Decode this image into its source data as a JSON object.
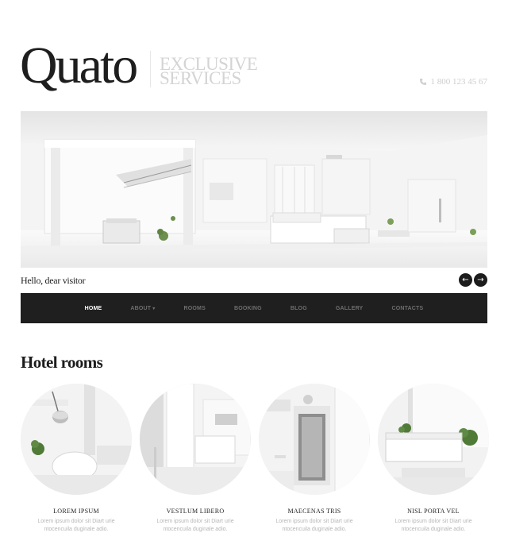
{
  "header": {
    "logo": "Quato",
    "tagline_line1": "EXCLUSIVE",
    "tagline_line2": "SERVICES",
    "phone": "1 800 123 45 67",
    "phone_icon": "phone-icon"
  },
  "hero": {
    "image": "white-living-room-interior"
  },
  "welcome": {
    "text": "Hello, dear visitor",
    "prev": "←",
    "next": "→"
  },
  "nav": {
    "items": [
      {
        "label": "HOME",
        "active": true
      },
      {
        "label": "ABOUT",
        "dropdown": true
      },
      {
        "label": "ROOMS"
      },
      {
        "label": "BOOKING"
      },
      {
        "label": "BLOG"
      },
      {
        "label": "GALLERY"
      },
      {
        "label": "CONTACTS"
      }
    ],
    "caret": "▾"
  },
  "rooms_section": {
    "title": "Hotel rooms",
    "rooms": [
      {
        "title": "LOREM IPSUM",
        "desc_line1": "Lorem ipsum dolor sit Diart urie",
        "desc_line2": "ntocencuila duginale adio."
      },
      {
        "title": "VESTLUM LIBERO",
        "desc_line1": "Lorem ipsum dolor sit Diart urie",
        "desc_line2": "ntocencuila duginale adio."
      },
      {
        "title": "MAECENAS TRIS",
        "desc_line1": "Lorem ipsum dolor sit Diart urie",
        "desc_line2": "ntocencuila duginale adio."
      },
      {
        "title": "NISL PORTA VEL",
        "desc_line1": "Lorem ipsum dolor sit Diart urie",
        "desc_line2": "ntocencuila duginale adio."
      }
    ]
  },
  "colors": {
    "nav_bg": "#1f1f1f",
    "nav_active": "#ffffff",
    "nav_inactive": "#6e6e6e",
    "tagline": "#d4d4d4",
    "muted_text": "#b6b6b6"
  }
}
